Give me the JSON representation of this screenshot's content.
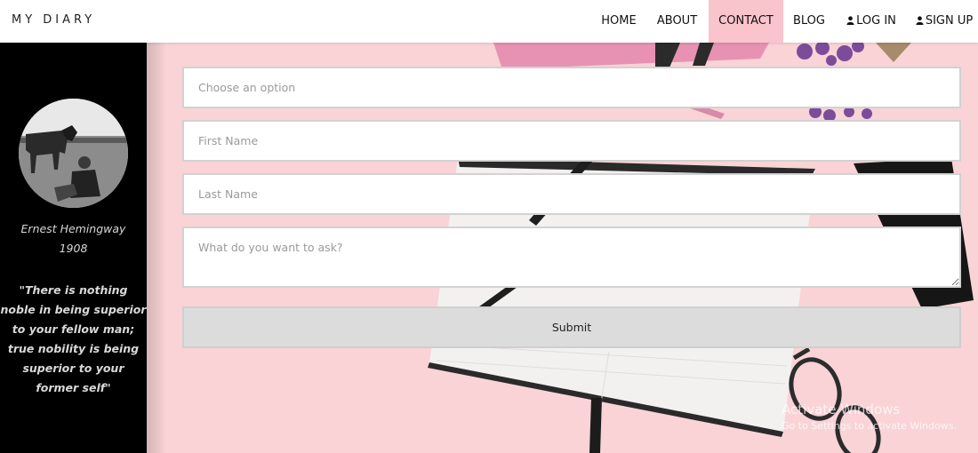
{
  "brand": "MY DIARY",
  "nav": {
    "items": [
      {
        "label": "HOME"
      },
      {
        "label": "ABOUT"
      },
      {
        "label": "CONTACT",
        "active": true
      },
      {
        "label": "BLOG"
      },
      {
        "label": "LOG IN",
        "icon": "user-icon"
      },
      {
        "label": "SIGN UP",
        "icon": "user-icon"
      }
    ]
  },
  "sidebar": {
    "name": "Ernest Hemingway",
    "year": "1908",
    "quote": "\"There is nothing noble in being superior to your fellow man; true nobility is being superior to your former self\""
  },
  "form": {
    "option_placeholder": "Choose an option",
    "first_name_placeholder": "First Name",
    "last_name_placeholder": "Last Name",
    "question_placeholder": "What do you want to ask?",
    "submit_label": "Submit"
  },
  "watermark": {
    "title": "Activate Windows",
    "subtitle": "Go to Settings to activate Windows."
  },
  "colors": {
    "accent": "#f9c4cc",
    "background": "#f9d3d6",
    "sidebar": "#000000"
  }
}
